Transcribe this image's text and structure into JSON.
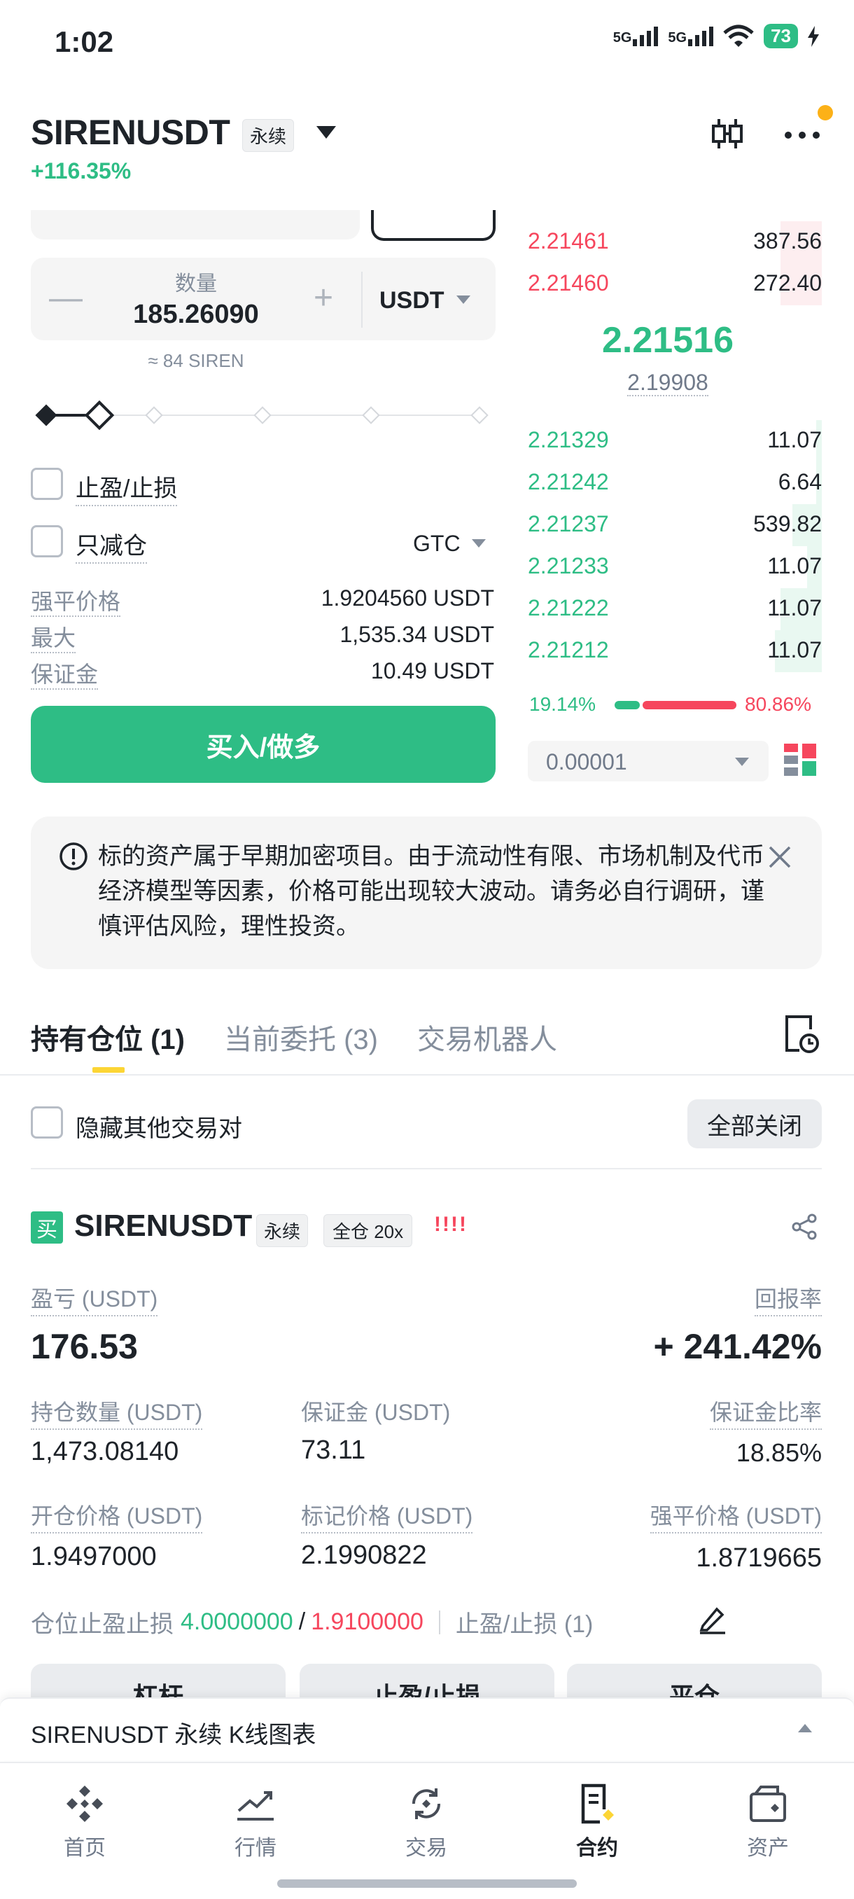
{
  "status_bar": {
    "time": "1:02",
    "network1": "5G",
    "network2": "5G",
    "battery": "73"
  },
  "header": {
    "symbol": "SIRENUSDT",
    "tag": "永续",
    "change": "+116.35%"
  },
  "order_form": {
    "quantity_label": "数量",
    "quantity_value": "185.26090",
    "quantity_unit": "USDT",
    "quantity_approx": "≈ 84 SIREN",
    "minus": "—",
    "plus": "+",
    "tpsl_label": "止盈/止损",
    "reduce_only_label": "只减仓",
    "time_in_force": "GTC",
    "info": {
      "liq_price_label": "强平价格",
      "liq_price_value": "1.9204560 USDT",
      "max_label": "最大",
      "max_value": "1,535.34 USDT",
      "margin_label": "保证金",
      "margin_value": "10.49 USDT"
    },
    "buy_button": "买入/做多"
  },
  "order_book": {
    "asks": [
      {
        "price": "2.21461",
        "qty": "387.56",
        "depth": 0.14
      },
      {
        "price": "2.21460",
        "qty": "272.40",
        "depth": 0.14
      }
    ],
    "last_price": "2.21516",
    "mark_price": "2.19908",
    "bids": [
      {
        "price": "2.21329",
        "qty": "11.07",
        "depth": 0.02
      },
      {
        "price": "2.21242",
        "qty": "6.64",
        "depth": 0.02
      },
      {
        "price": "2.21237",
        "qty": "539.82",
        "depth": 0.1
      },
      {
        "price": "2.21233",
        "qty": "11.07",
        "depth": 0.05
      },
      {
        "price": "2.21222",
        "qty": "11.07",
        "depth": 0.14
      },
      {
        "price": "2.21212",
        "qty": "11.07",
        "depth": 0.16
      }
    ],
    "buy_ratio": "19.14%",
    "sell_ratio": "80.86%",
    "precision": "0.00001"
  },
  "notice": {
    "text": "标的资产属于早期加密项目。由于流动性有限、市场机制及代币经济模型等因素，价格可能出现较大波动。请务必自行调研，谨慎评估风险，理性投资。"
  },
  "tabs": {
    "positions": "持有仓位 (1)",
    "open_orders": "当前委托 (3)",
    "bots": "交易机器人"
  },
  "positions_toolbar": {
    "hide_other_pairs": "隐藏其他交易对",
    "close_all": "全部关闭"
  },
  "position": {
    "side_badge": "买",
    "symbol": "SIRENUSDT",
    "tag_perp": "永续",
    "tag_margin": "全仓 20x",
    "alert": "!!!!",
    "pnl_label": "盈亏 (USDT)",
    "pnl_value": "176.53",
    "roe_label": "回报率",
    "roe_value": "+ 241.42%",
    "size_label": "持仓数量 (USDT)",
    "size_value": "1,473.08140",
    "margin_label": "保证金 (USDT)",
    "margin_value": "73.11",
    "margin_ratio_label": "保证金比率",
    "margin_ratio_value": "18.85%",
    "entry_label": "开仓价格 (USDT)",
    "entry_value": "1.9497000",
    "mark_label": "标记价格 (USDT)",
    "mark_value": "2.1990822",
    "liq_label": "强平价格 (USDT)",
    "liq_value": "1.8719665",
    "tpsl_prefix": "仓位止盈止损",
    "tp_value": "4.0000000",
    "slash": "/",
    "sl_value": "1.9100000",
    "tpsl_count": "止盈/止损 (1)",
    "btn_leverage": "杠杆",
    "btn_tpsl": "止盈/止损",
    "btn_close": "平仓"
  },
  "kline_bar": {
    "label": "SIRENUSDT 永续 K线图表"
  },
  "bottom_nav": {
    "home": "首页",
    "markets": "行情",
    "trade": "交易",
    "futures": "合约",
    "assets": "资产"
  },
  "colors": {
    "green": "#2ebd85",
    "red": "#f6465d",
    "yellow": "#fcd535"
  }
}
